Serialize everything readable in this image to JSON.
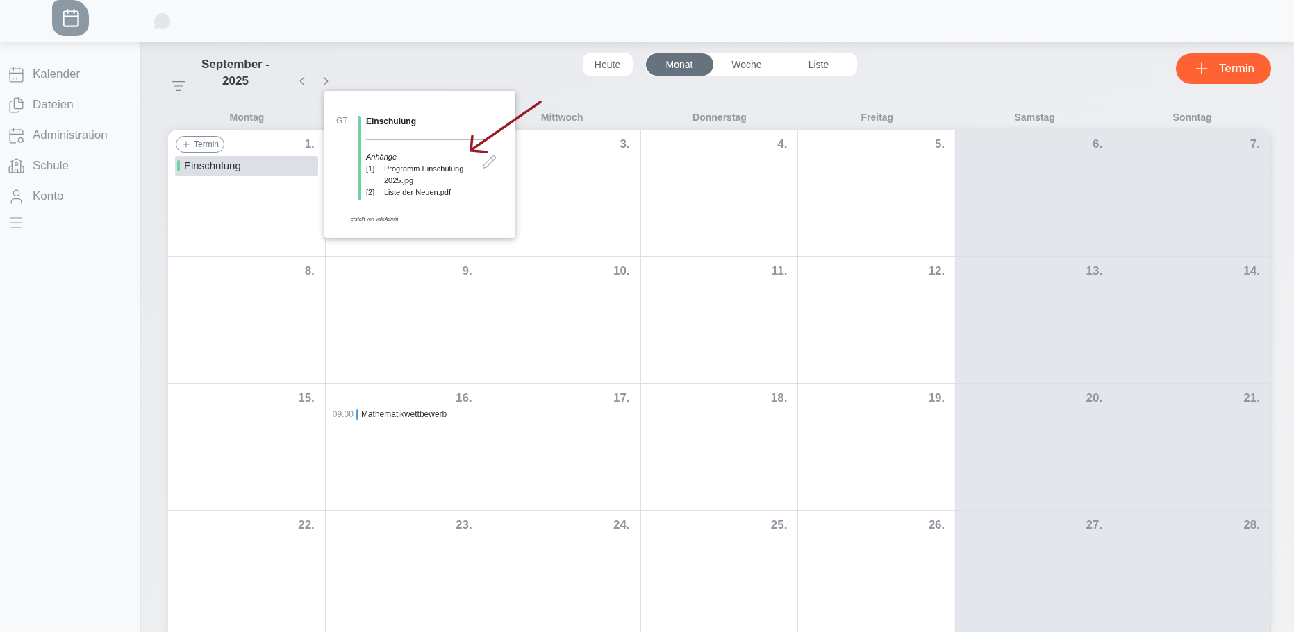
{
  "sidebar": {
    "items": [
      {
        "label": "Kalender"
      },
      {
        "label": "Dateien"
      },
      {
        "label": "Administration"
      },
      {
        "label": "Schule"
      },
      {
        "label": "Konto"
      }
    ]
  },
  "toolbar": {
    "title": [
      "September -",
      "2025"
    ],
    "today": "Heute",
    "views": [
      {
        "label": "Monat",
        "selected": true
      },
      {
        "label": "Woche",
        "selected": false
      },
      {
        "label": "Liste",
        "selected": false
      }
    ],
    "add_button": "Termin"
  },
  "weeks": [
    [
      {
        "weekday": "Montag",
        "day": "1.",
        "weekend": false,
        "add_button": "Termin",
        "events": [
          {
            "kind": "allday",
            "title": "Einschulung",
            "color": "#6dd3a5",
            "selected": true
          }
        ]
      },
      {
        "weekend": false
      },
      {
        "weekday": "Mittwoch",
        "day": "3.",
        "weekend": false
      },
      {
        "weekday": "Donnerstag",
        "day": "4.",
        "weekend": false
      },
      {
        "weekday": "Freitag",
        "day": "5.",
        "weekend": false
      },
      {
        "weekday": "Samstag",
        "day": "6.",
        "weekend": true
      },
      {
        "weekday": "Sonntag",
        "day": "7.",
        "weekend": true
      }
    ],
    [
      {
        "day": "8.",
        "weekend": false
      },
      {
        "day": "9.",
        "weekend": false
      },
      {
        "day": "10.",
        "weekend": false
      },
      {
        "day": "11.",
        "weekend": false
      },
      {
        "day": "12.",
        "weekend": false
      },
      {
        "day": "13.",
        "weekend": true
      },
      {
        "day": "14.",
        "weekend": true
      }
    ],
    [
      {
        "day": "15.",
        "weekend": false
      },
      {
        "day": "16.",
        "weekend": false,
        "events": [
          {
            "kind": "timed",
            "time": "09.00",
            "title": "Mathematikwettbewerb",
            "color": "#4a9fe0",
            "selected": false
          }
        ]
      },
      {
        "day": "17.",
        "weekend": false
      },
      {
        "day": "18.",
        "weekend": false
      },
      {
        "day": "19.",
        "weekend": false
      },
      {
        "day": "20.",
        "weekend": true
      },
      {
        "day": "21.",
        "weekend": true
      }
    ],
    [
      {
        "day": "22.",
        "weekend": false
      },
      {
        "day": "23.",
        "weekend": false
      },
      {
        "day": "24.",
        "weekend": false
      },
      {
        "day": "25.",
        "weekend": false
      },
      {
        "day": "26.",
        "weekend": false
      },
      {
        "day": "27.",
        "weekend": true
      },
      {
        "day": "28.",
        "weekend": true
      }
    ]
  ],
  "popup": {
    "marker": "GT",
    "title": "Einschulung",
    "color": "#6dd3a5",
    "attachments_heading": "Anhänge",
    "attachments": [
      {
        "index": "[1]",
        "name": "Programm Einschulung 2025.jpg"
      },
      {
        "index": "[2]",
        "name": "Liste der Neuen.pdf"
      }
    ],
    "footer": "erstellt von valeAdmin"
  }
}
